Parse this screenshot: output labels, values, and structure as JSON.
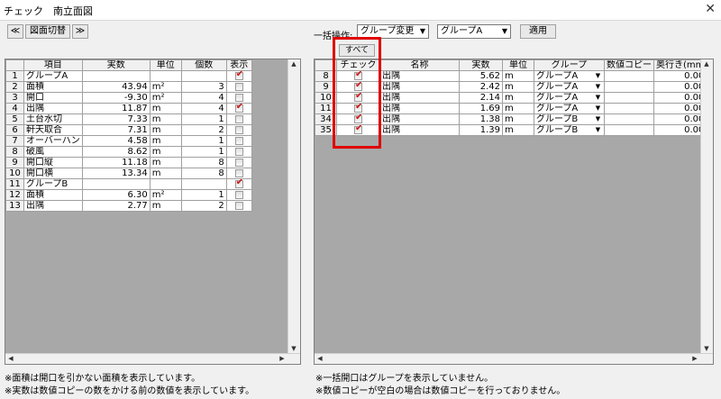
{
  "window": {
    "title": "チェック　南立面図",
    "close_glyph": "✕"
  },
  "left_toolbar": {
    "prev": "≪",
    "switch_label": "図面切替",
    "next": "≫"
  },
  "right_toolbar": {
    "bulk_label": "一括操作:",
    "operation_value": "グループ変更",
    "group_value": "グループA",
    "apply_label": "適用",
    "all_button_label": "すべて"
  },
  "left_table": {
    "headers": [
      "",
      "項目",
      "実数",
      "単位",
      "個数",
      "表示"
    ],
    "rows": [
      {
        "no": "1",
        "item": "グループA",
        "value": "",
        "unit": "",
        "count": "",
        "show": true
      },
      {
        "no": "2",
        "item": "面積",
        "value": "43.94",
        "unit": "m²",
        "count": "3",
        "show": false
      },
      {
        "no": "3",
        "item": "開口",
        "value": "-9.30",
        "unit": "m²",
        "count": "4",
        "show": false
      },
      {
        "no": "4",
        "item": "出隅",
        "value": "11.87",
        "unit": "m",
        "count": "4",
        "show": true
      },
      {
        "no": "5",
        "item": "土台水切",
        "value": "7.33",
        "unit": "m",
        "count": "1",
        "show": false
      },
      {
        "no": "6",
        "item": "軒天取合",
        "value": "7.31",
        "unit": "m",
        "count": "2",
        "show": false
      },
      {
        "no": "7",
        "item": "オーバーハン",
        "value": "4.58",
        "unit": "m",
        "count": "1",
        "show": false
      },
      {
        "no": "8",
        "item": "破風",
        "value": "8.62",
        "unit": "m",
        "count": "1",
        "show": false
      },
      {
        "no": "9",
        "item": "開口縦",
        "value": "11.18",
        "unit": "m",
        "count": "8",
        "show": false
      },
      {
        "no": "10",
        "item": "開口横",
        "value": "13.34",
        "unit": "m",
        "count": "8",
        "show": false
      },
      {
        "no": "11",
        "item": "グループB",
        "value": "",
        "unit": "",
        "count": "",
        "show": true
      },
      {
        "no": "12",
        "item": "面積",
        "value": "6.30",
        "unit": "m²",
        "count": "1",
        "show": false
      },
      {
        "no": "13",
        "item": "出隅",
        "value": "2.77",
        "unit": "m",
        "count": "2",
        "show": false
      }
    ]
  },
  "right_table": {
    "headers": [
      "",
      "チェック",
      "名称",
      "実数",
      "単位",
      "グループ",
      "数値コピー",
      "奥行き(mm"
    ],
    "rows": [
      {
        "no": "8",
        "check": true,
        "name": "出隅",
        "value": "5.62",
        "unit": "m",
        "group": "グループA",
        "copy": "",
        "depth": "0.00"
      },
      {
        "no": "9",
        "check": true,
        "name": "出隅",
        "value": "2.42",
        "unit": "m",
        "group": "グループA",
        "copy": "",
        "depth": "0.00"
      },
      {
        "no": "10",
        "check": true,
        "name": "出隅",
        "value": "2.14",
        "unit": "m",
        "group": "グループA",
        "copy": "",
        "depth": "0.00"
      },
      {
        "no": "11",
        "check": true,
        "name": "出隅",
        "value": "1.69",
        "unit": "m",
        "group": "グループA",
        "copy": "",
        "depth": "0.00"
      },
      {
        "no": "34",
        "check": true,
        "name": "出隅",
        "value": "1.38",
        "unit": "m",
        "group": "グループB",
        "copy": "",
        "depth": "0.00"
      },
      {
        "no": "35",
        "check": true,
        "name": "出隅",
        "value": "1.39",
        "unit": "m",
        "group": "グループB",
        "copy": "",
        "depth": "0.00"
      }
    ]
  },
  "notes_left": [
    "※面積は開口を引かない面積を表示しています。",
    "※実数は数値コピーの数をかける前の数値を表示しています。"
  ],
  "notes_right": [
    "※一括開口はグループを表示していません。",
    "※数値コピーが空白の場合は数値コピーを行っておりません。"
  ],
  "colors": {
    "highlight": "#e00000",
    "check": "#d01010",
    "grid_bg": "#a8a8a8"
  }
}
